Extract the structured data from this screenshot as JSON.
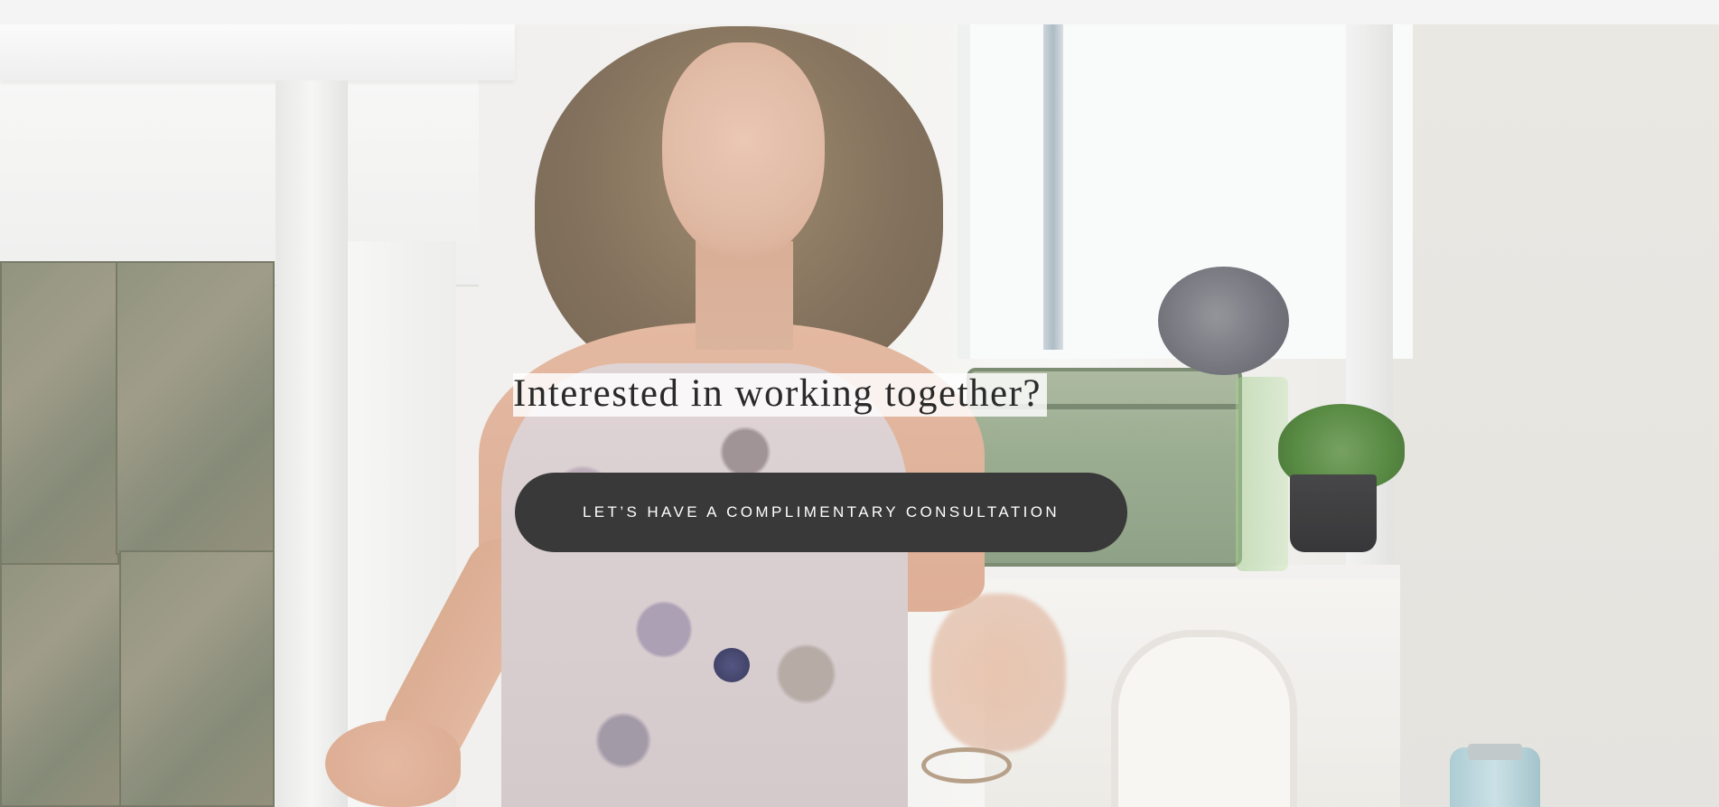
{
  "hero": {
    "video_frame_alt": "",
    "heading": "Interested in working together?",
    "cta_label": "LET’S HAVE A COMPLIMENTARY CONSULTATION"
  }
}
